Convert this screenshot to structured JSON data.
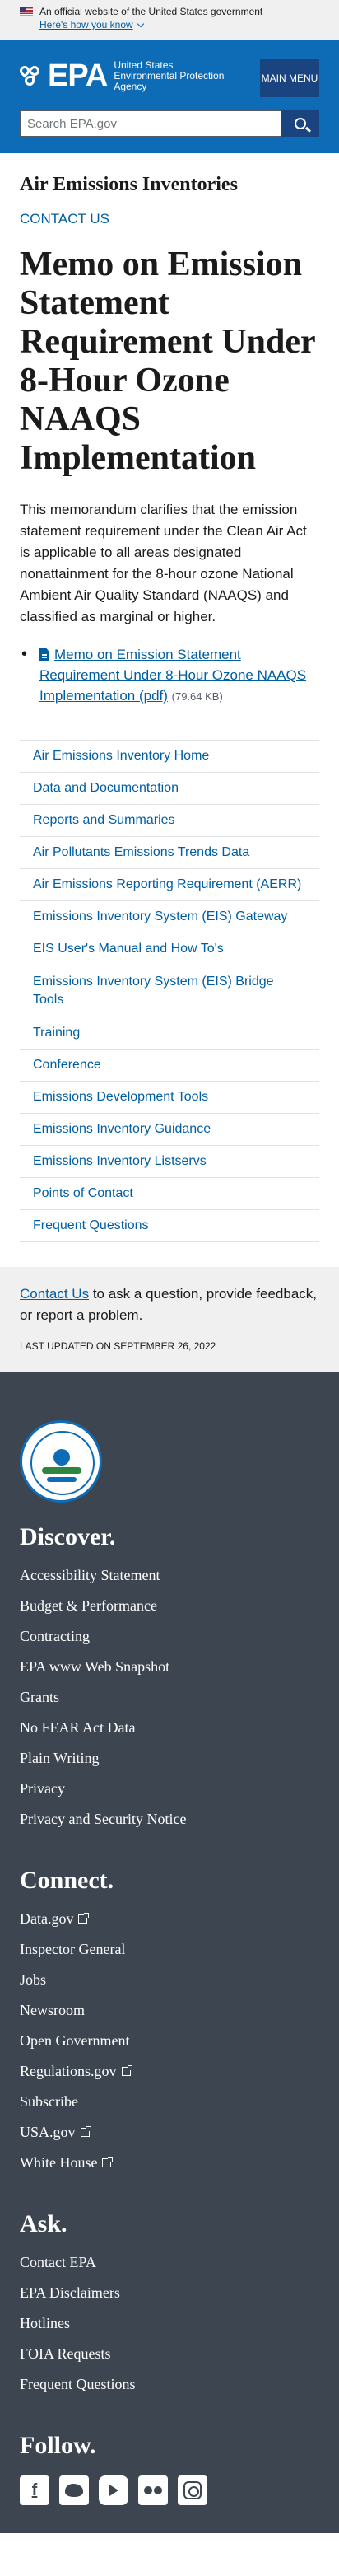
{
  "gov_banner": {
    "text": "An official website of the United States government",
    "link": "Here's how you know"
  },
  "header": {
    "logo": "EPA",
    "agency": "United States Environmental Protection Agency",
    "menu": "MAIN MENU",
    "search_placeholder": "Search EPA.gov",
    "search_icon": "magnifier-icon"
  },
  "main": {
    "series_title": "Air Emissions Inventories",
    "contact_link": "CONTACT US",
    "page_title": "Memo on Emission Statement Requirement Under 8-Hour Ozone NAAQS Implementation",
    "lede": "This memorandum clarifies that the emission statement requirement under the Clean Air Act is applicable to all areas designated nonattainment for the 8-hour ozone National Ambient Air Quality Standard (NAAQS) and classified as marginal or higher.",
    "document": {
      "link": "Memo on Emission Statement Requirement Under 8-Hour Ozone NAAQS Implementation (pdf)",
      "size": "(79.64 KB)"
    },
    "side_nav": [
      "Air Emissions Inventory Home",
      "Data and Documentation",
      "Reports and Summaries",
      "Air Pollutants Emissions Trends Data",
      "Air Emissions Reporting Requirement (AERR)",
      "Emissions Inventory System (EIS) Gateway",
      "EIS User's Manual and How To's",
      "Emissions Inventory System (EIS) Bridge Tools",
      "Training",
      "Conference",
      "Emissions Development Tools",
      "Emissions Inventory Guidance",
      "Emissions Inventory Listservs",
      "Points of Contact",
      "Frequent Questions"
    ]
  },
  "contact_box": {
    "link": "Contact Us",
    "text": "to ask a question, provide feedback, or report a problem.",
    "last_updated": "LAST UPDATED ON SEPTEMBER 26, 2022"
  },
  "footer": {
    "discover": {
      "heading": "Discover.",
      "items": [
        "Accessibility Statement",
        "Budget & Performance",
        "Contracting",
        "EPA www Web Snapshot",
        "Grants",
        "No FEAR Act Data",
        "Plain Writing",
        "Privacy",
        "Privacy and Security Notice"
      ]
    },
    "connect": {
      "heading": "Connect.",
      "items": [
        "Data.gov",
        "Inspector General",
        "Jobs",
        "Newsroom",
        "Open Government",
        "Regulations.gov",
        "Subscribe",
        "USA.gov",
        "White House"
      ]
    },
    "ask": {
      "heading": "Ask.",
      "items": [
        "Contact EPA",
        "EPA Disclaimers",
        "Hotlines",
        "FOIA Requests",
        "Frequent Questions"
      ]
    },
    "follow": {
      "heading": "Follow.",
      "icons": [
        "facebook-icon",
        "twitter-icon",
        "youtube-icon",
        "flickr-icon",
        "instagram-icon"
      ]
    }
  }
}
